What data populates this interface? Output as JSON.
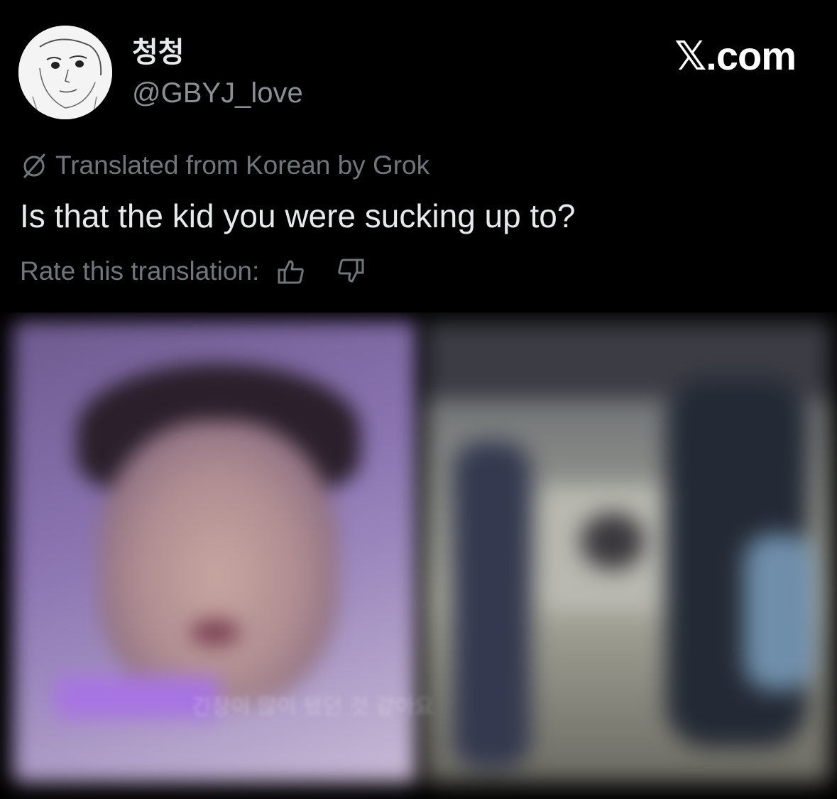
{
  "author": {
    "display_name": "청청",
    "handle": "@GBYJ_love"
  },
  "brand": "𝕏.com",
  "translation": {
    "note": "Translated from Korean by Grok",
    "icon": "grok-slash-icon"
  },
  "tweet": {
    "text": "Is that the kid you were sucking up to?"
  },
  "rating": {
    "label": "Rate this translation:",
    "up_icon": "thumb-up-icon",
    "down_icon": "thumb-down-icon"
  },
  "media": {
    "left_caption": "긴장이 많이 됐던 것 같아요"
  },
  "colors": {
    "background": "#000000",
    "primary_text": "#e7e9ea",
    "secondary_text": "#71767b",
    "caption_highlight": "#a774e2"
  }
}
